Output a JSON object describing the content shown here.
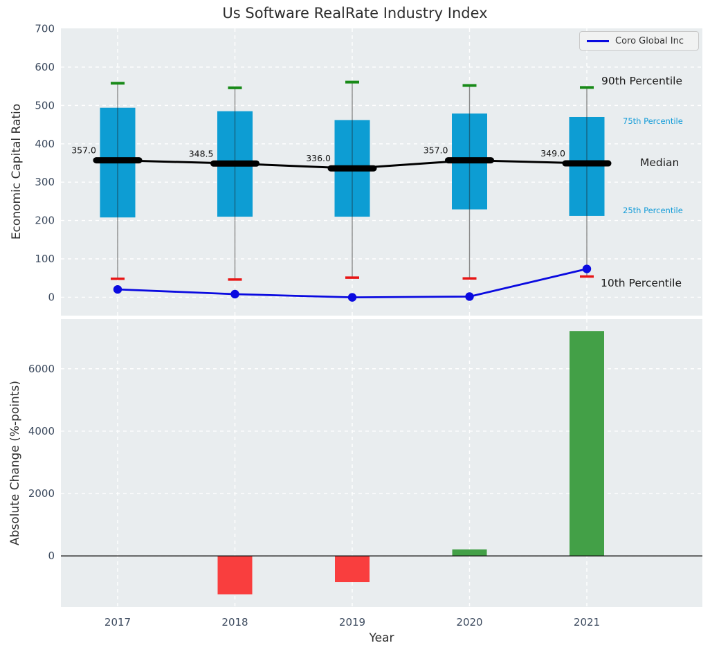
{
  "title": "Us Software RealRate Industry Index",
  "legend": {
    "label": "Coro Global Inc",
    "line_color": "#0a0ae0"
  },
  "annotations": {
    "p90": "90th Percentile",
    "p75": "75th Percentile",
    "median": "Median",
    "p25": "25th Percentile",
    "p10": "10th Percentile"
  },
  "colors": {
    "box_fill": "#0d9dd3",
    "whisker": "#8a8a8a",
    "cap_top_green": "#188a18",
    "cap_bottom_red": "#e81515",
    "median_black": "#000000",
    "company_line_blue": "#0a0ae0",
    "bar_positive_green": "#43a047",
    "bar_negative_red": "#f93e3e",
    "panel_background": "#e9edef",
    "gridline": "#ffffff",
    "tick_text": "#3d4b5f",
    "percentile_cyan": "#139cd8"
  },
  "chart_data": [
    {
      "type": "boxplot+line",
      "title": "Us Software RealRate Industry Index",
      "ylabel": "Economic Capital Ratio",
      "categories": [
        "2017",
        "2018",
        "2019",
        "2020",
        "2021"
      ],
      "yticks": [
        0,
        100,
        200,
        300,
        400,
        500,
        600,
        700
      ],
      "ylim": [
        -48,
        701
      ],
      "grid": true,
      "legend_position": "upper right",
      "boxes": [
        {
          "year": "2017",
          "p10": 48,
          "p25": 208,
          "median": 357.0,
          "p75": 494,
          "p90": 558,
          "median_label": "357.0"
        },
        {
          "year": "2018",
          "p10": 46,
          "p25": 210,
          "median": 348.5,
          "p75": 485,
          "p90": 546,
          "median_label": "348.5"
        },
        {
          "year": "2019",
          "p10": 51,
          "p25": 210,
          "median": 336.0,
          "p75": 462,
          "p90": 561,
          "median_label": "336.0"
        },
        {
          "year": "2020",
          "p10": 49,
          "p25": 229,
          "median": 357.0,
          "p75": 479,
          "p90": 552,
          "median_label": "357.0"
        },
        {
          "year": "2021",
          "p10": 54,
          "p25": 212,
          "median": 349.0,
          "p75": 470,
          "p90": 547,
          "median_label": "349.0"
        }
      ],
      "series": [
        {
          "name": "Coro Global Inc",
          "values": [
            20.3,
            8.0,
            -0.4,
            1.7,
            73.8
          ]
        }
      ]
    },
    {
      "type": "bar",
      "ylabel": "Absolute Change (%-points)",
      "xlabel": "Year",
      "categories": [
        "2017",
        "2018",
        "2019",
        "2020",
        "2021"
      ],
      "values": [
        null,
        -1230,
        -840,
        210,
        7210
      ],
      "yticks": [
        0,
        2000,
        4000,
        6000
      ],
      "ylim": [
        -1660,
        7592
      ],
      "grid": true
    }
  ]
}
